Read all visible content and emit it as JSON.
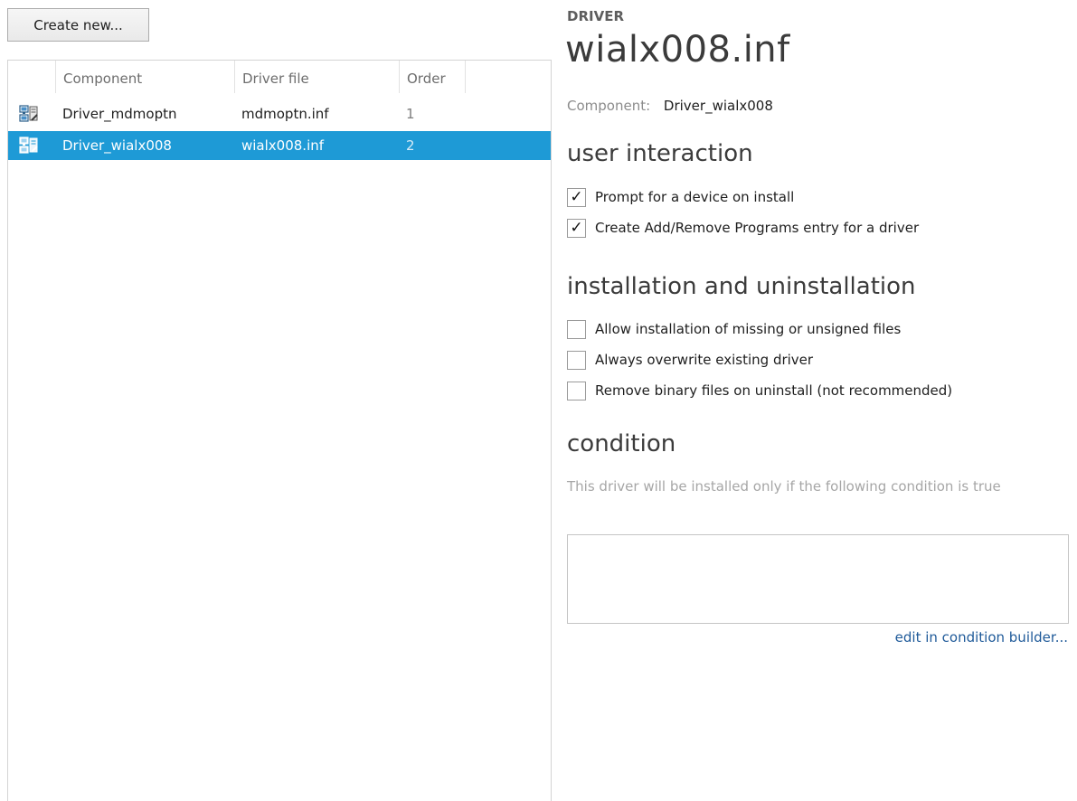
{
  "toolbar": {
    "create_label": "Create new..."
  },
  "table": {
    "columns": [
      "Component",
      "Driver file",
      "Order"
    ],
    "rows": [
      {
        "component": "Driver_mdmoptn",
        "file": "mdmoptn.inf",
        "order": "1",
        "icon": "driver-icon",
        "selected": false
      },
      {
        "component": "Driver_wialx008",
        "file": "wialx008.inf",
        "order": "2",
        "icon": "driver-icon",
        "selected": true
      }
    ]
  },
  "detail": {
    "kicker": "DRIVER",
    "title": "wialx008.inf",
    "component_label": "Component:",
    "component_value": "Driver_wialx008",
    "user_interaction": {
      "title": "user interaction",
      "options": [
        {
          "label": "Prompt for a device on install",
          "checked": true
        },
        {
          "label": "Create Add/Remove Programs entry for a driver",
          "checked": true
        }
      ]
    },
    "install": {
      "title": "installation and uninstallation",
      "options": [
        {
          "label": "Allow installation of missing or unsigned files",
          "checked": false
        },
        {
          "label": "Always overwrite existing driver",
          "checked": false
        },
        {
          "label": "Remove binary files on uninstall (not recommended)",
          "checked": false
        }
      ]
    },
    "condition": {
      "title": "condition",
      "description": "This driver will be installed only if the following condition is true",
      "value": "",
      "edit_link": "edit in condition builder..."
    }
  },
  "colors": {
    "selection": "#1e9ad6",
    "link": "#1f5a99"
  }
}
